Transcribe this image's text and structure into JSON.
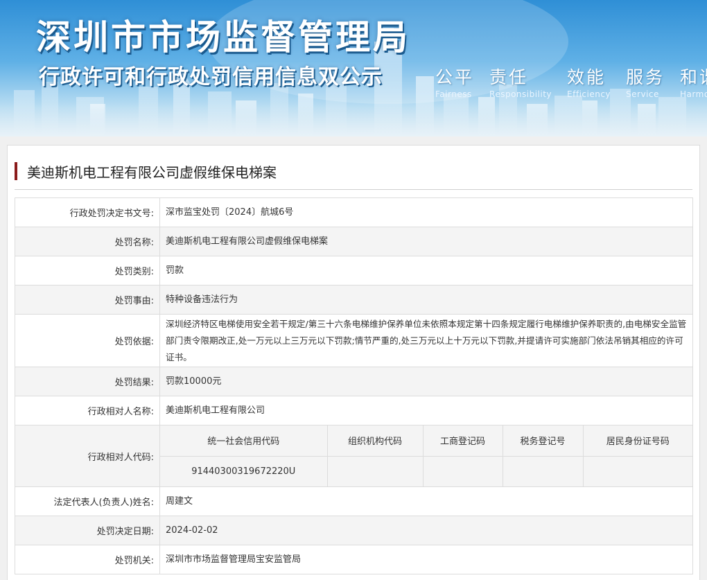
{
  "banner": {
    "title": "深圳市市场监督管理局",
    "subtitle": "行政许可和行政处罚信用信息双公示",
    "values": [
      {
        "cn": "公平",
        "en": "Fairness"
      },
      {
        "cn": "责任",
        "en": "Responsibility"
      },
      {
        "cn": "效能",
        "en": "Efficiency"
      },
      {
        "cn": "服务",
        "en": "Service"
      },
      {
        "cn": "和谐",
        "en": "Harmony"
      }
    ]
  },
  "case": {
    "title": "美迪斯机电工程有限公司虚假维保电梯案"
  },
  "fields": {
    "decision_no": {
      "label": "行政处罚决定书文号:",
      "value": "深市监宝处罚〔2024〕航城6号"
    },
    "penalty_name": {
      "label": "处罚名称:",
      "value": "美迪斯机电工程有限公司虚假维保电梯案"
    },
    "penalty_type": {
      "label": "处罚类别:",
      "value": "罚款"
    },
    "penalty_reason": {
      "label": "处罚事由:",
      "value": "特种设备违法行为"
    },
    "penalty_basis": {
      "label": "处罚依据:",
      "value": "深圳经济特区电梯使用安全若干规定/第三十六条电梯维护保养单位未依照本规定第十四条规定履行电梯维护保养职责的,由电梯安全监管部门责令限期改正,处一万元以上三万元以下罚款;情节严重的,处三万元以上十万元以下罚款,并提请许可实施部门依法吊销其相应的许可证书。"
    },
    "penalty_result": {
      "label": "处罚结果:",
      "value": "罚款10000元"
    },
    "party_name": {
      "label": "行政相对人名称:",
      "value": "美迪斯机电工程有限公司"
    },
    "party_code": {
      "label": "行政相对人代码:",
      "headers": [
        "统一社会信用代码",
        "组织机构代码",
        "工商登记码",
        "税务登记号",
        "居民身份证号码"
      ],
      "values": [
        "91440300319672220U",
        "",
        "",
        "",
        ""
      ]
    },
    "legal_rep": {
      "label": "法定代表人(负责人)姓名:",
      "value": "周建文"
    },
    "decision_date": {
      "label": "处罚决定日期:",
      "value": "2024-02-02"
    },
    "authority": {
      "label": "处罚机关:",
      "value": "深圳市市场监督管理局宝安监管局"
    }
  },
  "colors": {
    "title_accent": "#8b1c1c",
    "banner_sky": "#2f8fd6",
    "row_alt": "#f4f4f4",
    "border": "#dcdcdc"
  }
}
